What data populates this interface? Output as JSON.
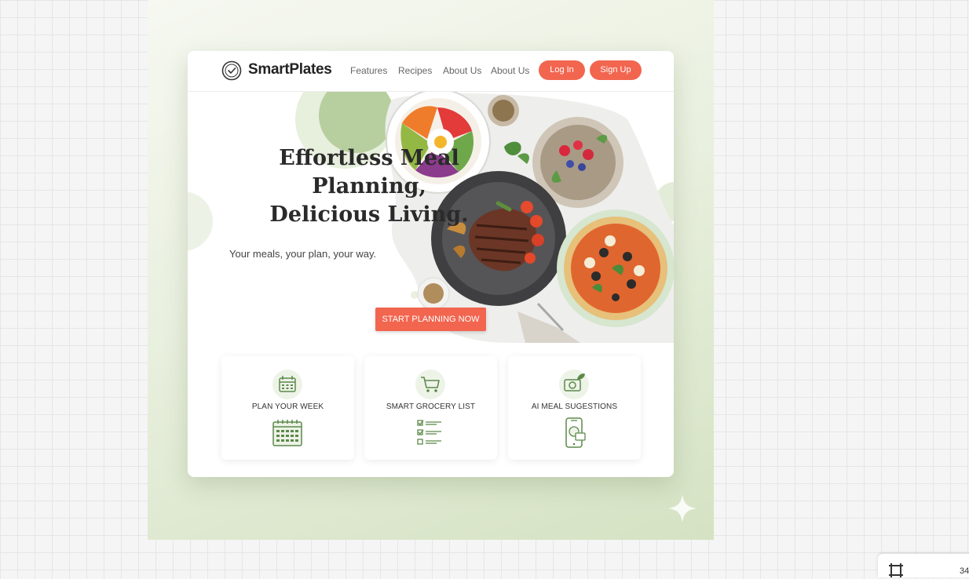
{
  "nav": {
    "brand": "SmartPlates",
    "links": [
      "Features",
      "Recipes",
      "About Us",
      "About Us"
    ],
    "login_label": "Log In",
    "signup_label": "Sign Up"
  },
  "hero": {
    "headline_line1": "Effortless Meal Planning,",
    "headline_line2": "Delicious Living.",
    "subline": "Your meals, your plan, your way.",
    "cta_label": "START PLANNING NOW"
  },
  "features": [
    {
      "label": "PLAN YOUR WEEK",
      "icon_top": "calendar-icon",
      "icon_bottom": "calendar-grid-icon"
    },
    {
      "label": "SMART GROCERY LIST",
      "icon_top": "shopping-cart-icon",
      "icon_bottom": "checklist-icon"
    },
    {
      "label": "AI MEAL SUGESTIONS",
      "icon_top": "camera-leaf-icon",
      "icon_bottom": "phone-meal-icon"
    }
  ],
  "footer_chip": {
    "text": "34"
  },
  "colors": {
    "accent": "#f2654f",
    "green": "#5c8a4a",
    "canvas_bg": "#dfe9d2"
  }
}
